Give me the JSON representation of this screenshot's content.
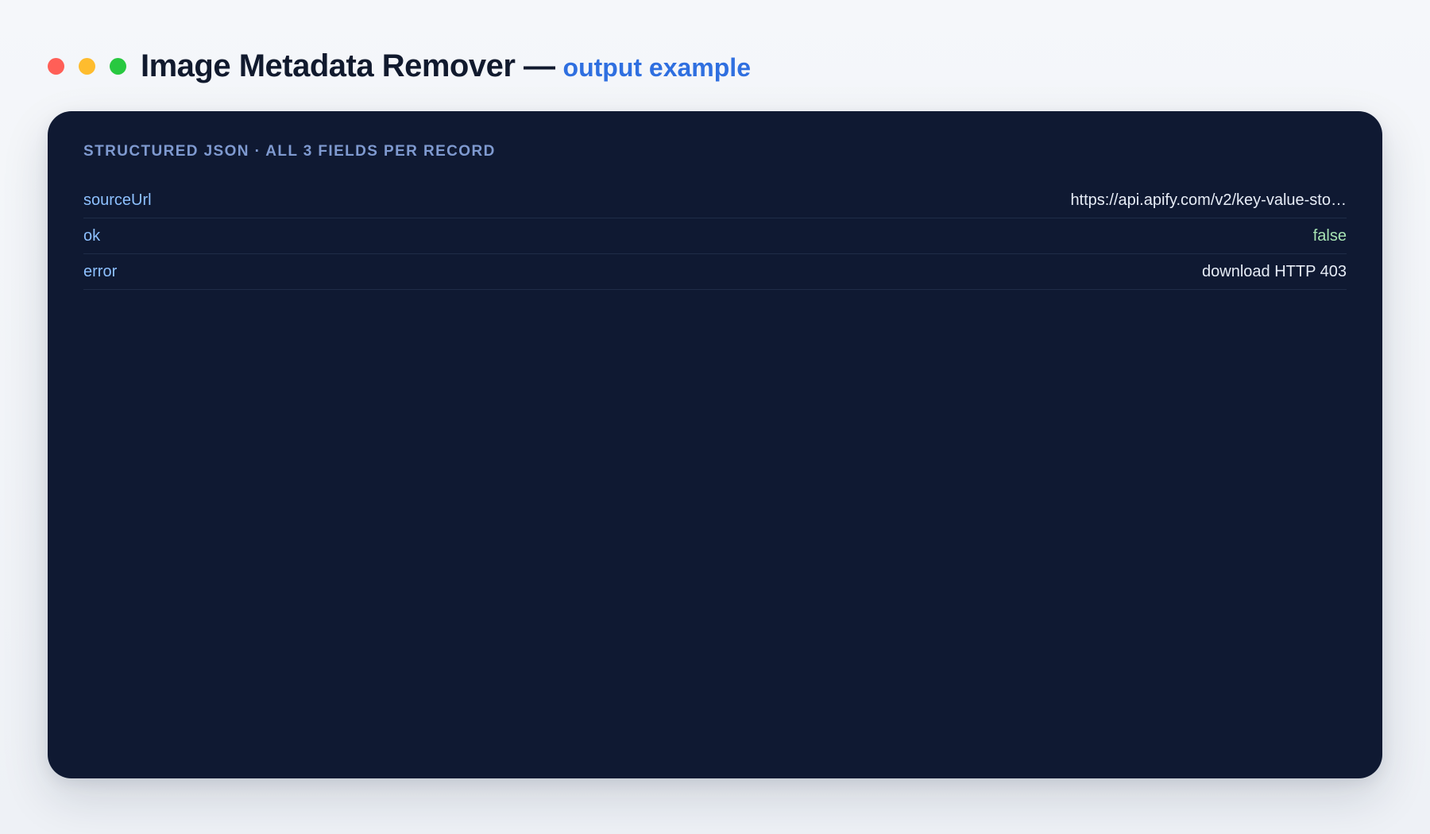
{
  "window": {
    "title": "Image Metadata Remover —",
    "subtitle": "output example",
    "traffic_lights": [
      "close",
      "minimize",
      "maximize"
    ]
  },
  "panel": {
    "caption": "STRUCTURED JSON · ALL 3 FIELDS PER RECORD",
    "rows": [
      {
        "key": "sourceUrl",
        "value": "https://api.apify.com/v2/key-value-sto…"
      },
      {
        "key": "ok",
        "value": "false"
      },
      {
        "key": "error",
        "value": "download HTTP 403"
      }
    ]
  },
  "colors": {
    "background": "#f2f5f9",
    "panel": "#0f1932",
    "accent": "#2f6fe0",
    "key": "#8dc0ff",
    "value": "#e6ecf6",
    "boolean": "#a7e3b3",
    "close_dot": "#ff5f57",
    "minimize_dot": "#febc2e",
    "maximize_dot": "#28c840"
  }
}
